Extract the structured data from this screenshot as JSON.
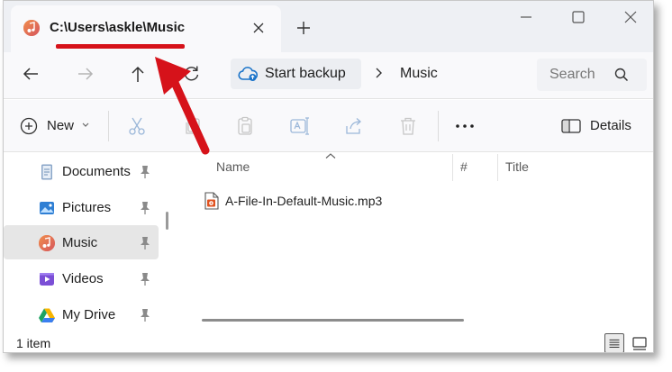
{
  "window": {
    "tab_title": "C:\\Users\\askle\\Music"
  },
  "address_bar": {
    "backup_label": "Start backup",
    "current_folder": "Music",
    "search_placeholder": "Search"
  },
  "command_bar": {
    "new_label": "New",
    "details_label": "Details"
  },
  "sidebar": {
    "items": [
      {
        "label": "Documents",
        "icon": "documents-icon",
        "pinned": true,
        "selected": false
      },
      {
        "label": "Pictures",
        "icon": "pictures-icon",
        "pinned": true,
        "selected": false
      },
      {
        "label": "Music",
        "icon": "music-icon",
        "pinned": true,
        "selected": true
      },
      {
        "label": "Videos",
        "icon": "videos-icon",
        "pinned": true,
        "selected": false
      },
      {
        "label": "My Drive",
        "icon": "google-drive-icon",
        "pinned": true,
        "selected": false
      }
    ]
  },
  "file_list": {
    "columns": [
      "Name",
      "#",
      "Title"
    ],
    "files": [
      {
        "name": "A-File-In-Default-Music.mp3"
      }
    ]
  },
  "status": {
    "item_count": "1 item"
  },
  "colors": {
    "annotation_red": "#d6121a",
    "music_icon_orange": "#e8734a",
    "backup_blue": "#1a73c9"
  }
}
